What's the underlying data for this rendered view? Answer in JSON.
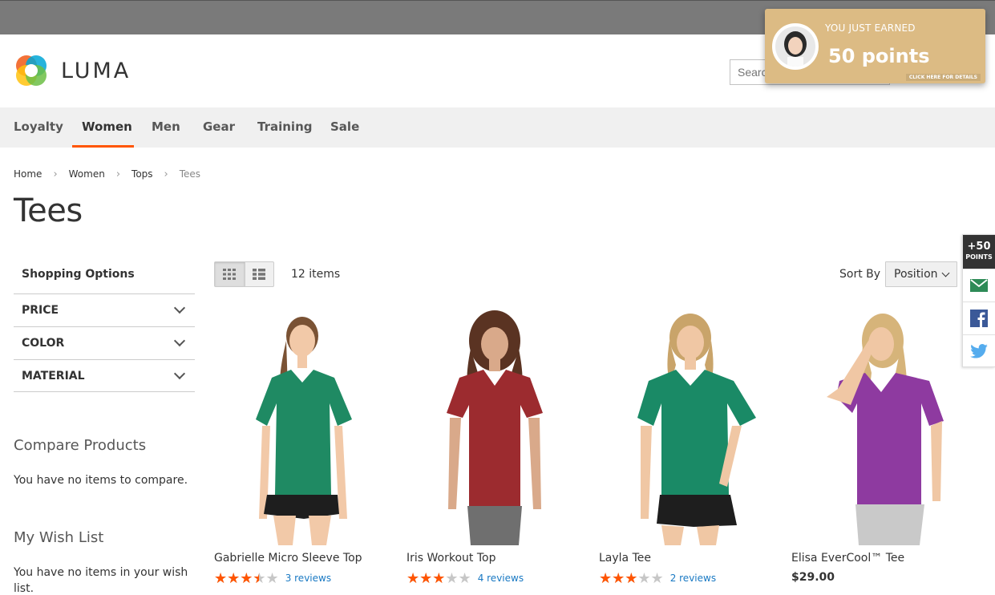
{
  "brand": {
    "name": "LUMA"
  },
  "search": {
    "placeholder": "Search entire store here..."
  },
  "nav": {
    "items": [
      {
        "label": "Loyalty",
        "active": false
      },
      {
        "label": "Women",
        "active": true
      },
      {
        "label": "Men",
        "active": false
      },
      {
        "label": "Gear",
        "active": false
      },
      {
        "label": "Training",
        "active": false
      },
      {
        "label": "Sale",
        "active": false
      }
    ]
  },
  "breadcrumb": [
    "Home",
    "Women",
    "Tops",
    "Tees"
  ],
  "page": {
    "title": "Tees"
  },
  "sidebar": {
    "heading": "Shopping Options",
    "filters": [
      "PRICE",
      "COLOR",
      "MATERIAL"
    ],
    "compare": {
      "title": "Compare Products",
      "text": "You have no items to compare."
    },
    "wishlist": {
      "title": "My Wish List",
      "text": "You have no items in your wish list."
    }
  },
  "toolbar": {
    "count": "12 items",
    "sort_label": "Sort By",
    "sort_value": "Position"
  },
  "products": [
    {
      "name": "Gabrielle Micro Sleeve Top",
      "rating": 0.7,
      "reviews": "3 reviews",
      "shirt_color": "#1f8a63"
    },
    {
      "name": "Iris Workout Top",
      "rating": 0.6,
      "reviews": "4 reviews",
      "shirt_color": "#9c2b2f"
    },
    {
      "name": "Layla Tee",
      "rating": 0.6,
      "reviews": "2 reviews",
      "shirt_color": "#1a8a66"
    },
    {
      "name": "Elisa EverCool™ Tee",
      "price": "$29.00",
      "shirt_color": "#8e3aa0"
    }
  ],
  "popup": {
    "heading": "YOU JUST EARNED",
    "points": "50 points",
    "footer": "CLICK HERE FOR DETAILS"
  },
  "social": {
    "points": "+50",
    "points_label": "POINTS"
  },
  "colors": {
    "accent": "#ff5501",
    "link": "#1979c3",
    "popup_bg": "#dcbb84",
    "nav_bg": "#f0f0f0"
  }
}
